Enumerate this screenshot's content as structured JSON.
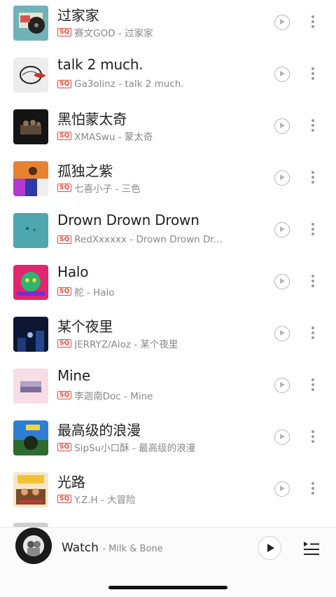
{
  "songs": [
    {
      "title": "过家家",
      "quality": "SQ",
      "subtitle": "赛文GOD - 过家家"
    },
    {
      "title": "talk 2 much.",
      "quality": "SQ",
      "subtitle": "Ga3olinz - talk 2 much."
    },
    {
      "title": "黑怕蒙太奇",
      "quality": "SQ",
      "subtitle": "XMASwu - 蒙太奇"
    },
    {
      "title": "孤独之紫",
      "quality": "SQ",
      "subtitle": "七喜小子 - 三色"
    },
    {
      "title": "Drown Drown Drown",
      "quality": "SQ",
      "subtitle": "RedXxxxxx - Drown Drown Dr..."
    },
    {
      "title": "Halo",
      "quality": "SQ",
      "subtitle": "舵 - Halo"
    },
    {
      "title": "某个夜里",
      "quality": "SQ",
      "subtitle": "JERRYZ/Aioz - 某个夜里"
    },
    {
      "title": "Mine",
      "quality": "SQ",
      "subtitle": "李迦南Doc - Mine"
    },
    {
      "title": "最高级的浪漫",
      "quality": "SQ",
      "subtitle": "SipSu小口酥 - 最高级的浪漫"
    },
    {
      "title": "光路",
      "quality": "SQ",
      "subtitle": "Y.Z.H - 大冒险"
    }
  ],
  "now_playing": {
    "title": "Watch",
    "artist": "Milk & Bone"
  },
  "icons": {
    "play": "play-circle-icon",
    "more": "more-vertical-icon",
    "queue": "playlist-queue-icon"
  },
  "colors": {
    "sq_badge": "#e8493e",
    "text_primary": "#222222",
    "text_secondary": "#888888"
  }
}
